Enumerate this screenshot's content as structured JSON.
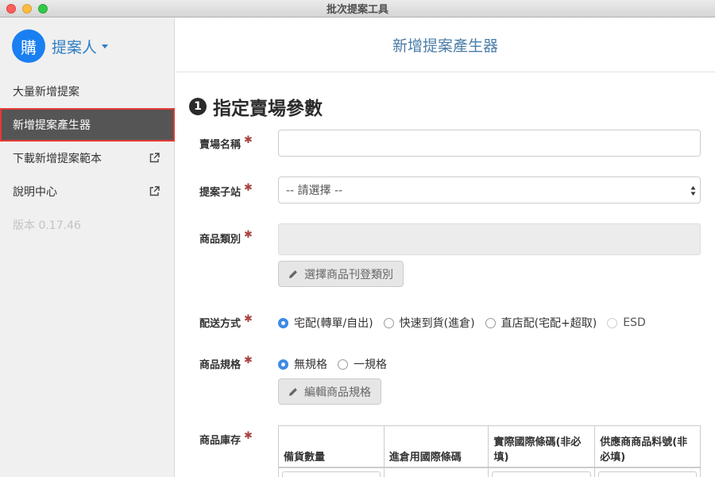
{
  "window": {
    "title": "批次提案工具"
  },
  "sidebar": {
    "avatar_text": "購",
    "user_name": "提案人",
    "items": [
      {
        "label": "大量新增提案",
        "active": false,
        "external": false
      },
      {
        "label": "新增提案產生器",
        "active": true,
        "external": false
      },
      {
        "label": "下載新增提案範本",
        "active": false,
        "external": true
      },
      {
        "label": "說明中心",
        "active": false,
        "external": true
      }
    ],
    "version": "版本 0.17.46"
  },
  "main": {
    "header_title": "新增提案產生器",
    "section": {
      "number": "❶",
      "title": "指定賣場參數"
    },
    "fields": {
      "store_name": {
        "label": "賣場名稱",
        "required": "✱",
        "value": ""
      },
      "sub_site": {
        "label": "提案子站",
        "required": "✱",
        "selected": "-- 請選擇 --"
      },
      "category": {
        "label": "商品類別",
        "required": "✱",
        "button": "選擇商品刊登類別"
      },
      "shipping": {
        "label": "配送方式",
        "required": "✱",
        "options": [
          "宅配(轉單/自出)",
          "快速到貨(進倉)",
          "直店配(宅配+超取)",
          "ESD"
        ],
        "selected_index": 0
      },
      "spec": {
        "label": "商品規格",
        "required": "✱",
        "options": [
          "無規格",
          "一規格"
        ],
        "selected_index": 0,
        "button": "編輯商品規格"
      },
      "stock": {
        "label": "商品庫存",
        "required": "✱",
        "columns": [
          "備貨數量",
          "進倉用國際條碼",
          "實際國際條碼(非必填)",
          "供應商商品料號(非必填)"
        ]
      }
    }
  },
  "colors": {
    "accent": "#1a7ff0",
    "active_nav": "#555555",
    "highlight_border": "#e53935",
    "required": "#a94442"
  }
}
